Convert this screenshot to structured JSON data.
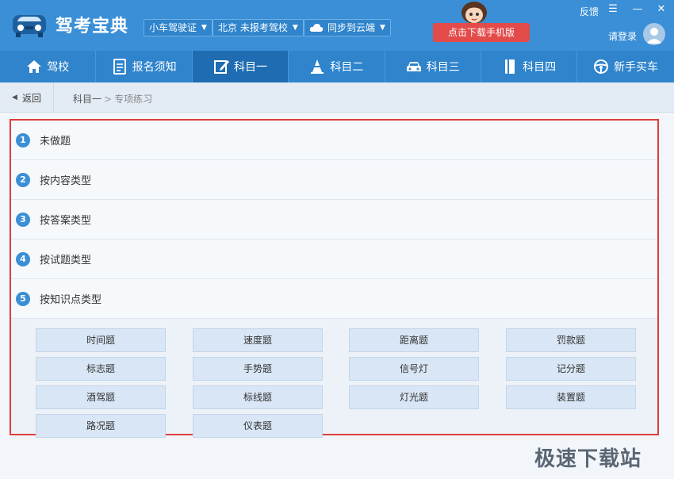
{
  "app": {
    "title": "驾考宝典"
  },
  "header": {
    "dropdowns": [
      {
        "label": "小车驾驶证"
      },
      {
        "label": "北京 未报考驾校"
      },
      {
        "label": "同步到云端",
        "icon": "cloud-icon"
      }
    ],
    "download_button": "点击下载手机版",
    "feedback": "反馈",
    "login": "请登录"
  },
  "nav": {
    "items": [
      {
        "label": "驾校",
        "icon": "home-icon"
      },
      {
        "label": "报名须知",
        "icon": "document-icon"
      },
      {
        "label": "科目一",
        "icon": "edit-icon",
        "active": true
      },
      {
        "label": "科目二",
        "icon": "cone-icon"
      },
      {
        "label": "科目三",
        "icon": "car-icon"
      },
      {
        "label": "科目四",
        "icon": "book-icon"
      },
      {
        "label": "新手买车",
        "icon": "steering-wheel-icon"
      }
    ]
  },
  "breadcrumb": {
    "back": "返回",
    "parent": "科目一",
    "separator": ">",
    "current": "专项练习"
  },
  "categories": [
    {
      "num": "1",
      "label": "未做题"
    },
    {
      "num": "2",
      "label": "按内容类型"
    },
    {
      "num": "3",
      "label": "按答案类型"
    },
    {
      "num": "4",
      "label": "按试题类型"
    },
    {
      "num": "5",
      "label": "按知识点类型"
    }
  ],
  "topics": [
    "时间题",
    "速度题",
    "距离题",
    "罚款题",
    "标志题",
    "手势题",
    "信号灯",
    "记分题",
    "酒驾题",
    "标线题",
    "灯光题",
    "装置题",
    "路况题",
    "仪表题"
  ],
  "watermark": "极速下载站",
  "colors": {
    "header": "#3a8fd6",
    "nav": "#2f84cc",
    "nav_active": "#1f6cb2",
    "highlight": "#e03c3c",
    "download": "#e34a4a"
  }
}
